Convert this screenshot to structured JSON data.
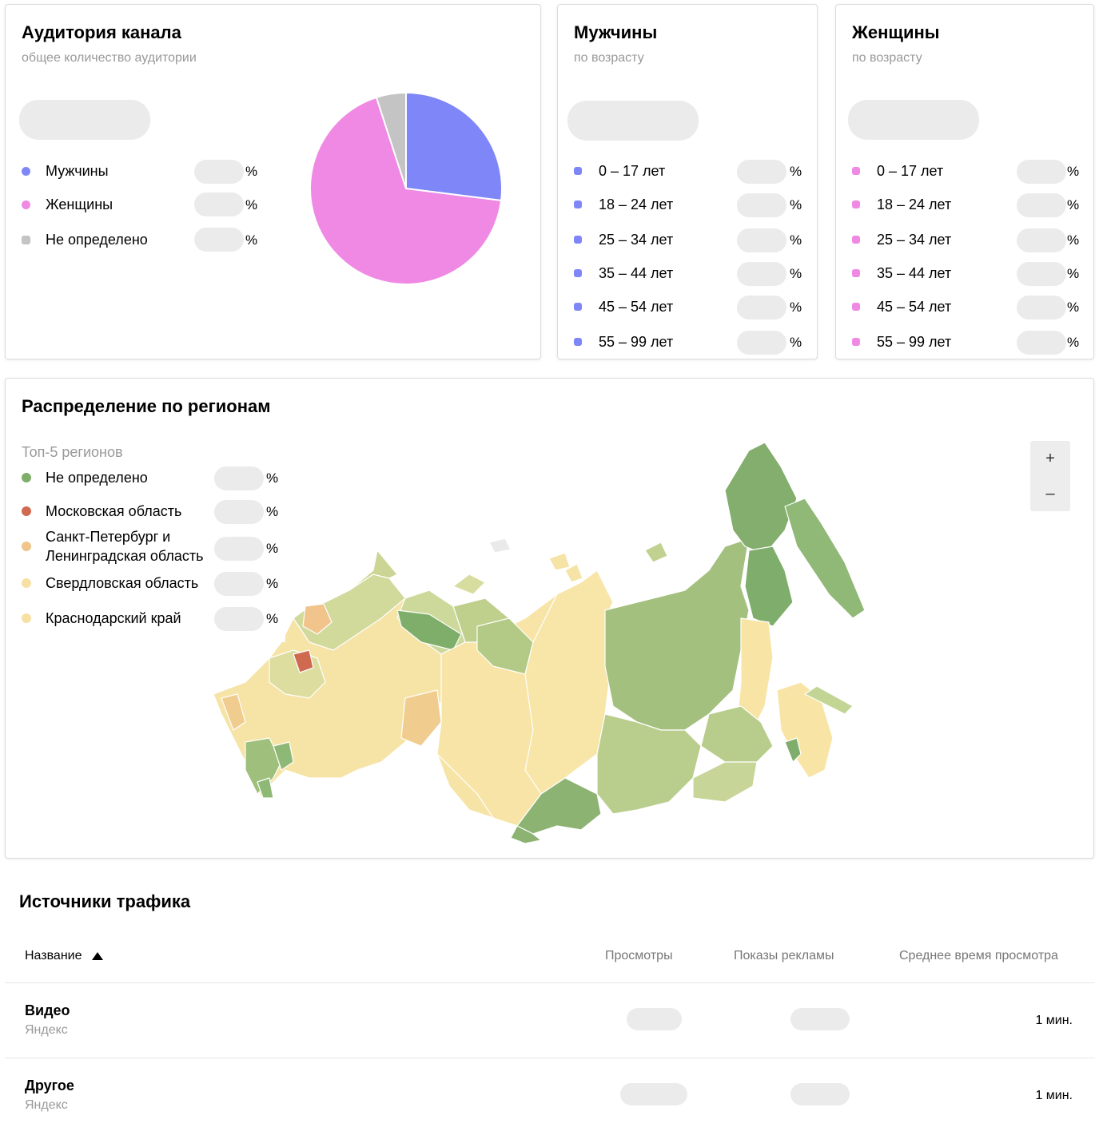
{
  "audience": {
    "title": "Аудитория канала",
    "subtitle": "общее количество аудитории",
    "legend": [
      {
        "label": "Мужчины",
        "color": "#7f86f7",
        "unit": "%"
      },
      {
        "label": "Женщины",
        "color": "#ef89e4",
        "unit": "%"
      },
      {
        "label": "Не определено",
        "color": "#c4c4c4",
        "unit": "%"
      }
    ]
  },
  "chart_data": {
    "type": "pie",
    "categories": [
      "Мужчины",
      "Женщины",
      "Не определено"
    ],
    "values": [
      27,
      68,
      5
    ],
    "colors": [
      "#7f86f7",
      "#ef89e4",
      "#c4c4c4"
    ]
  },
  "men": {
    "title": "Мужчины",
    "subtitle": "по возрасту",
    "color": "#7f86f7",
    "ages": [
      "0 – 17 лет",
      "18 – 24 лет",
      "25 – 34 лет",
      "35 – 44 лет",
      "45 – 54 лет",
      "55 – 99 лет"
    ],
    "unit": "%"
  },
  "women": {
    "title": "Женщины",
    "subtitle": "по возрасту",
    "color": "#ef89e4",
    "ages": [
      "0 – 17 лет",
      "18 – 24 лет",
      "25 – 34 лет",
      "35 – 44 лет",
      "45 – 54 лет",
      "55 – 99 лет"
    ],
    "unit": "%"
  },
  "regions": {
    "title": "Распределение по регионам",
    "top_label": "Топ-5 регионов",
    "items": [
      {
        "label": "Не определено",
        "color": "#7fae6a"
      },
      {
        "label": "Московская область",
        "color": "#cf6a50"
      },
      {
        "label": "Санкт-Петербург и",
        "label2": "Ленинградская область",
        "color": "#f0c48a"
      },
      {
        "label": "Свердловская область",
        "color": "#f6e0a4"
      },
      {
        "label": "Краснодарский край",
        "color": "#f6e0a4"
      }
    ],
    "unit": "%",
    "zoom_in": "+",
    "zoom_out": "–"
  },
  "traffic": {
    "title": "Источники трафика",
    "columns": {
      "name": "Название",
      "views": "Просмотры",
      "ads": "Показы рекламы",
      "avg_time": "Среднее время просмотра"
    },
    "rows": [
      {
        "name": "Видео",
        "source": "Яндекс",
        "avg_time": "1 мин."
      },
      {
        "name": "Другое",
        "source": "Яндекс",
        "avg_time": "1 мин."
      }
    ]
  }
}
